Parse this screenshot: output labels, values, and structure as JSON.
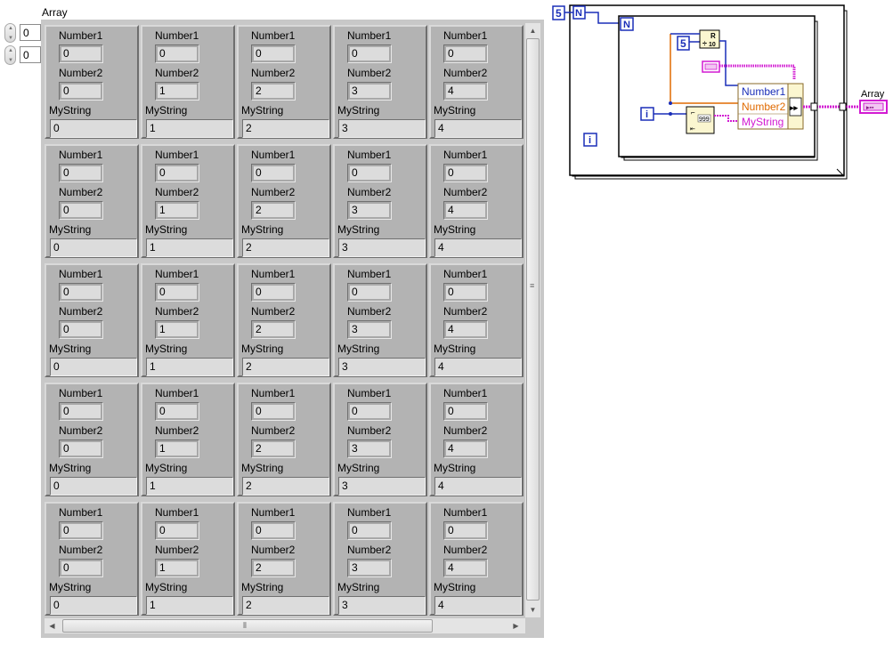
{
  "front_panel": {
    "array_label": "Array",
    "index_row": "0",
    "index_col": "0",
    "field_labels": {
      "number1": "Number1",
      "number2": "Number2",
      "mystring": "MyString"
    },
    "rows": [
      {
        "cells": [
          {
            "n1": "0",
            "n2": "0",
            "s": "0"
          },
          {
            "n1": "0",
            "n2": "1",
            "s": "1"
          },
          {
            "n1": "0",
            "n2": "2",
            "s": "2"
          },
          {
            "n1": "0",
            "n2": "3",
            "s": "3"
          },
          {
            "n1": "0",
            "n2": "4",
            "s": "4"
          }
        ]
      },
      {
        "cells": [
          {
            "n1": "0",
            "n2": "0",
            "s": "0"
          },
          {
            "n1": "0",
            "n2": "1",
            "s": "1"
          },
          {
            "n1": "0",
            "n2": "2",
            "s": "2"
          },
          {
            "n1": "0",
            "n2": "3",
            "s": "3"
          },
          {
            "n1": "0",
            "n2": "4",
            "s": "4"
          }
        ]
      },
      {
        "cells": [
          {
            "n1": "0",
            "n2": "0",
            "s": "0"
          },
          {
            "n1": "0",
            "n2": "1",
            "s": "1"
          },
          {
            "n1": "0",
            "n2": "2",
            "s": "2"
          },
          {
            "n1": "0",
            "n2": "3",
            "s": "3"
          },
          {
            "n1": "0",
            "n2": "4",
            "s": "4"
          }
        ]
      },
      {
        "cells": [
          {
            "n1": "0",
            "n2": "0",
            "s": "0"
          },
          {
            "n1": "0",
            "n2": "1",
            "s": "1"
          },
          {
            "n1": "0",
            "n2": "2",
            "s": "2"
          },
          {
            "n1": "0",
            "n2": "3",
            "s": "3"
          },
          {
            "n1": "0",
            "n2": "4",
            "s": "4"
          }
        ]
      },
      {
        "cells": [
          {
            "n1": "0",
            "n2": "0",
            "s": "0"
          },
          {
            "n1": "0",
            "n2": "1",
            "s": "1"
          },
          {
            "n1": "0",
            "n2": "2",
            "s": "2"
          },
          {
            "n1": "0",
            "n2": "3",
            "s": "3"
          },
          {
            "n1": "0",
            "n2": "4",
            "s": "4"
          }
        ]
      }
    ]
  },
  "block_diagram": {
    "outer_count": "5",
    "outer_N": "N",
    "inner_N": "N",
    "inner_count": "5",
    "iteration_inner": "i",
    "iteration_outer": "i",
    "bundle_fields": [
      "Number1",
      "Number2",
      "MyString"
    ],
    "indicator_label": "Array",
    "random_label": "R",
    "random_sub": "10",
    "format_value": "999",
    "colors": {
      "int_blue": "#1a2eb8",
      "string_pink": "#d21ad2",
      "dbl_orange": "#e06a00",
      "cluster_brown": "#8a6a28"
    }
  }
}
